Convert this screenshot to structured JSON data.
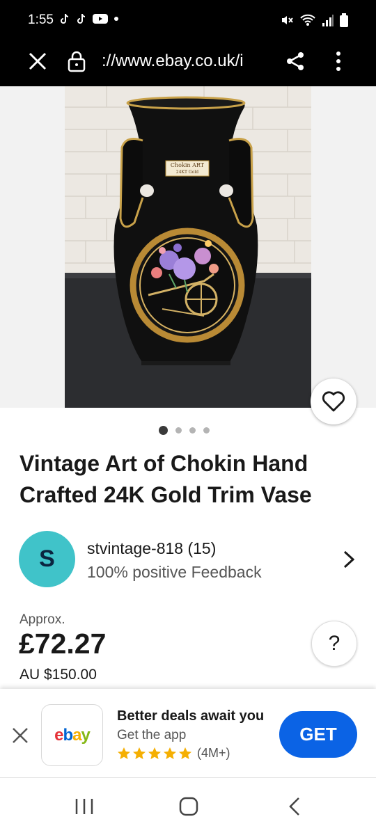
{
  "status_bar": {
    "time": "1:55"
  },
  "browser": {
    "url": "://www.ebay.co.uk/i"
  },
  "listing": {
    "photo_label_line1": "Chokin ART",
    "photo_label_line2": "24KT Gold",
    "image_count": 4,
    "active_image": 1,
    "title": "Vintage Art of Chokin Hand Crafted 24K Gold Trim Vase"
  },
  "seller": {
    "initial": "S",
    "name": "stvintage-818 (15)",
    "feedback": "100% positive Feedback",
    "avatar_color": "#40c3c9"
  },
  "price": {
    "approx_label": "Approx.",
    "amount": "£72.27",
    "original": "AU $150.00",
    "help_label": "?"
  },
  "app_banner": {
    "logo_letters": [
      "e",
      "b",
      "a",
      "y"
    ],
    "title": "Better deals await you",
    "subtitle": "Get the app",
    "stars": 5,
    "rating_count": "(4M+)",
    "get_label": "GET",
    "button_color": "#0b63e5"
  }
}
